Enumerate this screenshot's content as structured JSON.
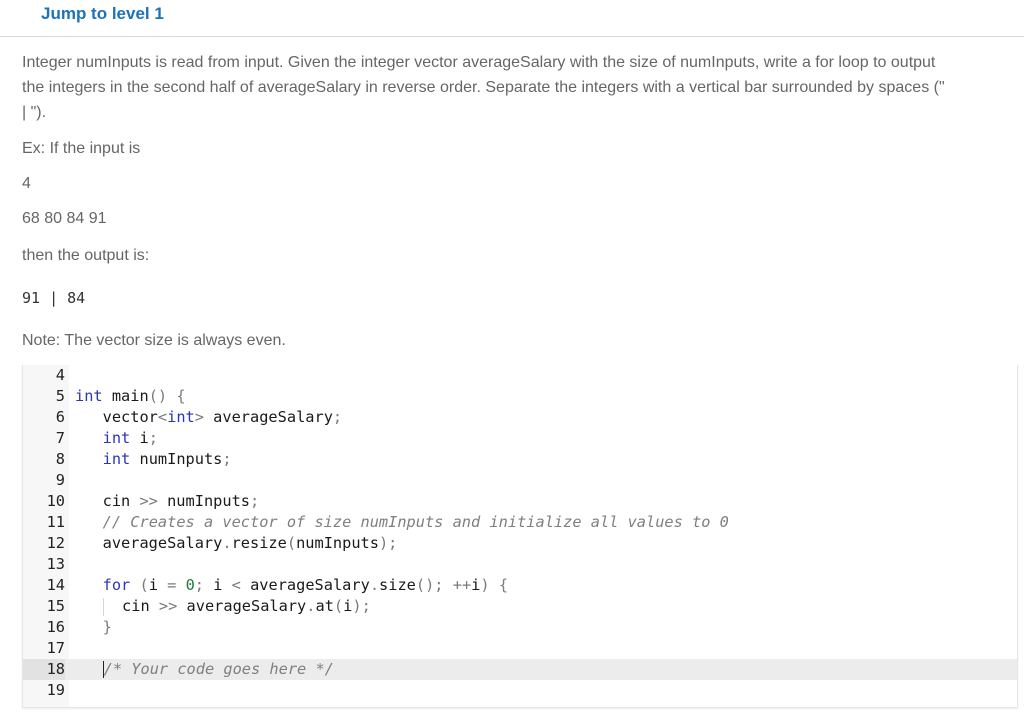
{
  "header": {
    "jump_link": "Jump to level 1"
  },
  "prompt": {
    "line1": "Integer numInputs is read from input. Given the integer vector averageSalary with the size of numInputs, write a for loop to output",
    "line2": "the integers in the second half of averageSalary in reverse order. Separate the integers with a vertical bar surrounded by spaces (\"",
    "line3": "| \").",
    "example_intro": "Ex: If the input is",
    "input_line1": "4",
    "input_line2": "68 80 84 91",
    "output_intro": "then the output is:",
    "output_value": "91 | 84",
    "note": "Note: The vector size is always even."
  },
  "editor": {
    "lines": [
      {
        "n": "4",
        "text": ""
      },
      {
        "n": "5",
        "text": "int main() {"
      },
      {
        "n": "6",
        "text": "   vector<int> averageSalary;"
      },
      {
        "n": "7",
        "text": "   int i;"
      },
      {
        "n": "8",
        "text": "   int numInputs;"
      },
      {
        "n": "9",
        "text": ""
      },
      {
        "n": "10",
        "text": "   cin >> numInputs;"
      },
      {
        "n": "11",
        "text": "   // Creates a vector of size numInputs and initialize all values to 0"
      },
      {
        "n": "12",
        "text": "   averageSalary.resize(numInputs);"
      },
      {
        "n": "13",
        "text": ""
      },
      {
        "n": "14",
        "text": "   for (i = 0; i < averageSalary.size(); ++i) {"
      },
      {
        "n": "15",
        "text": "      cin >> averageSalary.at(i);"
      },
      {
        "n": "16",
        "text": "   }"
      },
      {
        "n": "17",
        "text": ""
      },
      {
        "n": "18",
        "text": "   /* Your code goes here */"
      },
      {
        "n": "19",
        "text": ""
      }
    ]
  }
}
